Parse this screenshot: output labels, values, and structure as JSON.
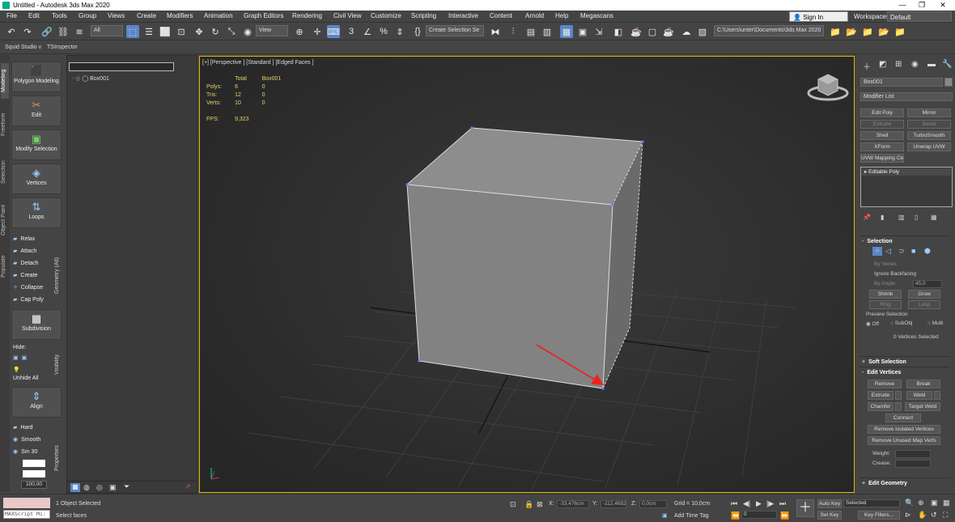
{
  "window": {
    "title": "Untitled - Autodesk 3ds Max 2020",
    "minimize": "—",
    "maximize": "❐",
    "close": "✕"
  },
  "menu": [
    "File",
    "Edit",
    "Tools",
    "Group",
    "Views",
    "Create",
    "Modifiers",
    "Animation",
    "Graph Editors",
    "Rendering",
    "Civil View",
    "Customize",
    "Scripting",
    "Interactive",
    "Content",
    "Arnold",
    "Help",
    "Megascans"
  ],
  "account": {
    "sign_in": "Sign In",
    "workspaces_label": "Workspaces:",
    "workspace": "Default"
  },
  "toolbar": {
    "filter": "All",
    "ref_coord": "View",
    "selection_set": "Create Selection Se",
    "project_path": "C:\\Users\\unter\\Documents\\3ds Max 2020"
  },
  "ribbon_tabs": [
    "Squid Studio v",
    "TSInspector"
  ],
  "side_tabs": [
    "Modeling",
    "Freeform",
    "Selection",
    "Object Paint",
    "Populate"
  ],
  "ribbon": {
    "polygon_modeling": "Polygon Modeling",
    "edit": "Edit",
    "modify_selection": "Modify Selection",
    "vertices": "Vertices",
    "loops": "Loops",
    "geometry": [
      "Relax",
      "Attach",
      "Detach",
      "Create",
      "Collapse",
      "Cap Poly"
    ],
    "geometry_group": "Geometry (All)",
    "subdivision": "Subdivision",
    "hide": "Hide:",
    "unhide_all": "Unhide All",
    "visibility_group": "Visibility",
    "align": "Align",
    "properties": [
      "Hard",
      "Smooth",
      "Sm 30"
    ],
    "properties_group": "Properties",
    "spinner": "100,00"
  },
  "scene": {
    "object": "Box001"
  },
  "viewport": {
    "label": "[+] [Perspective ] [Standard ] [Edged Faces ]",
    "stats": {
      "header_total": "Total",
      "header_obj": "Box001",
      "rows": [
        {
          "k": "Polys:",
          "a": "6",
          "b": "0"
        },
        {
          "k": "Tris:",
          "a": "12",
          "b": "0"
        },
        {
          "k": "Verts:",
          "a": "10",
          "b": "0"
        }
      ],
      "fps_label": "FPS:",
      "fps": "9,323"
    }
  },
  "command_panel": {
    "object_name": "Box001",
    "modifier_list": "Modifier List",
    "buttons": [
      "Edit Poly",
      "Mirror",
      "Extrude",
      "Bevel",
      "Shell",
      "TurboSmooth",
      "XForm",
      "Unwrap UVW",
      "UVW Mapping Clear"
    ],
    "stack_item": "Editable Poly",
    "selection": {
      "title": "Selection",
      "by_vertex": "By Vertex",
      "ignore_backfacing": "Ignore Backfacing",
      "by_angle": "By Angle:",
      "angle": "45,0",
      "shrink": "Shrink",
      "grow": "Grow",
      "ring": "Ring",
      "loop": "Loop",
      "preview": "Preview Selection",
      "off": "Off",
      "subobj": "SubObj",
      "multi": "Multi",
      "status": "0 Vertices Selected"
    },
    "soft_selection": "Soft Selection",
    "edit_vertices": {
      "title": "Edit Vertices",
      "remove": "Remove",
      "break": "Break",
      "extrude": "Extrude",
      "weld": "Weld",
      "chamfer": "Chamfer",
      "target_weld": "Target Weld",
      "connect": "Connect",
      "remove_isolated": "Remove Isolated Vertices",
      "remove_unused": "Remove Unused Map Verts",
      "weight": "Weight:",
      "crease": "Crease:"
    },
    "edit_geometry": "Edit Geometry"
  },
  "status": {
    "maxscript": "MAXScript Mi:",
    "selected": "1 Object Selected",
    "prompt": "Select faces",
    "x_label": "X:",
    "x": "-33,476cm",
    "y_label": "Y:",
    "y": "-112,4682",
    "z_label": "Z:",
    "z": "0,0cm",
    "grid": "Grid = 10,0cm",
    "add_time_tag": "Add Time Tag",
    "frame": "0",
    "auto_key": "Auto Key",
    "set_key": "Set Key",
    "key_mode": "Selected",
    "key_filters": "Key Filters..."
  }
}
